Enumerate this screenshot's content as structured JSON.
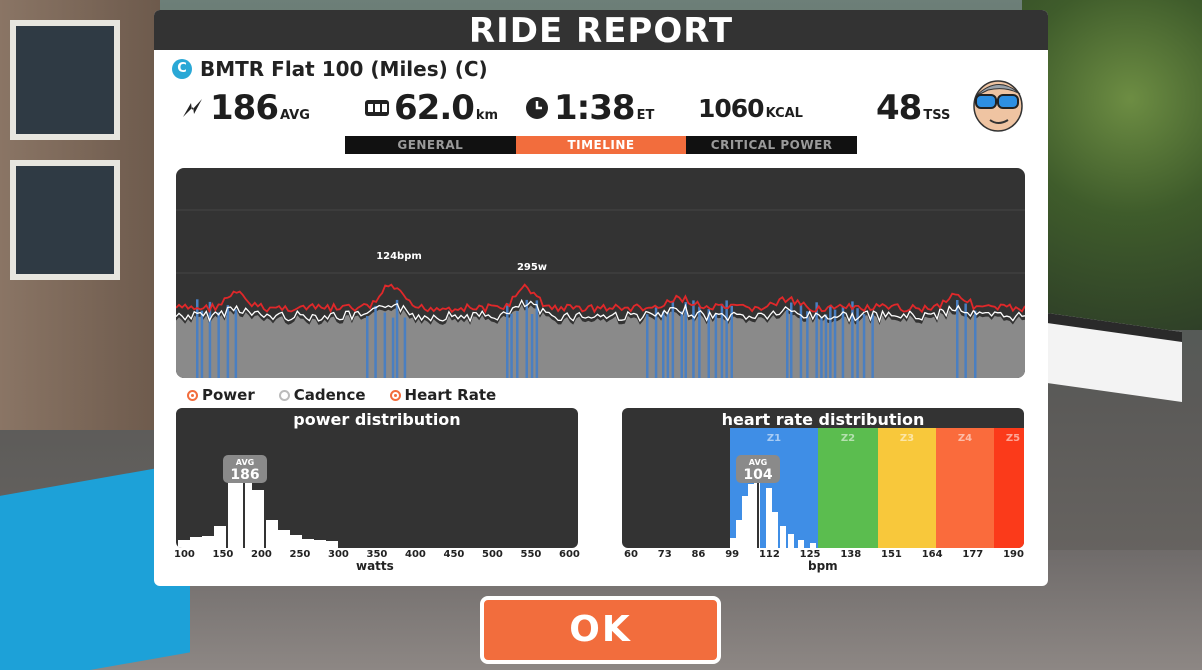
{
  "dialog": {
    "title": "RIDE REPORT",
    "route_badge": "C",
    "route_name": "BMTR Flat 100 (Miles) (C)"
  },
  "stats": {
    "power": {
      "value": "186",
      "unit": "AVG",
      "icon": "power-bolt-icon"
    },
    "distance": {
      "value": "62.0",
      "unit": "km",
      "icon": "odometer-icon"
    },
    "time": {
      "value": "1:38",
      "unit": "ET",
      "icon": "clock-icon"
    },
    "calories": {
      "value": "1060",
      "unit": "KCAL"
    },
    "tss": {
      "value": "48",
      "unit": "TSS"
    },
    "avatar": "rider-avatar-icon"
  },
  "tabs": [
    {
      "label": "GENERAL",
      "active": false
    },
    {
      "label": "TIMELINE",
      "active": true
    },
    {
      "label": "CRITICAL POWER",
      "active": false
    }
  ],
  "timeline": {
    "hr_peak_label": "124bpm",
    "power_peak_label": "295w",
    "legend": [
      "Power",
      "Cadence",
      "Heart Rate"
    ],
    "colors": {
      "power": "#4a7fc1",
      "cadence": "#ffffff",
      "heart_rate": "#e0282a",
      "fill": "#8a8a8a"
    }
  },
  "power_distribution": {
    "title": "power distribution",
    "avg_label": "AVG",
    "avg_value": "186",
    "x_label": "watts",
    "ticks": [
      "100",
      "150",
      "200",
      "250",
      "300",
      "350",
      "400",
      "450",
      "500",
      "550",
      "600"
    ]
  },
  "hr_distribution": {
    "title": "heart rate distribution",
    "avg_label": "AVG",
    "avg_value": "104",
    "x_label": "bpm",
    "ticks": [
      "60",
      "73",
      "86",
      "99",
      "112",
      "125",
      "138",
      "151",
      "164",
      "177",
      "190"
    ],
    "zones": [
      {
        "label": "Z1",
        "color": "#3f8ee6"
      },
      {
        "label": "Z2",
        "color": "#5bbd4f"
      },
      {
        "label": "Z3",
        "color": "#f8c83b"
      },
      {
        "label": "Z4",
        "color": "#fa6b3c"
      },
      {
        "label": "Z5",
        "color": "#fb3a1a"
      }
    ]
  },
  "ok_button": "OK"
}
